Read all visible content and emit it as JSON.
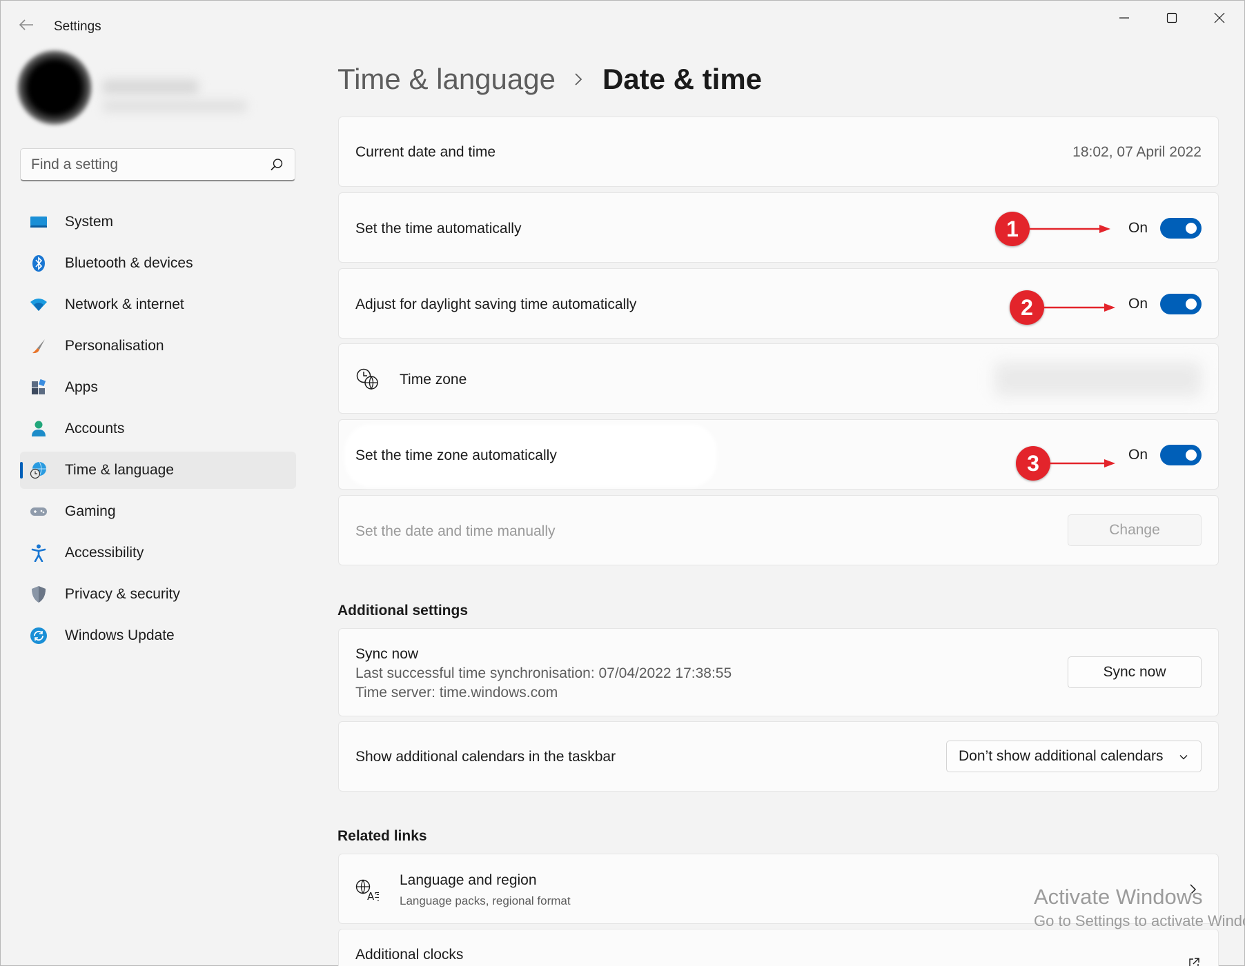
{
  "window": {
    "app_title": "Settings",
    "back_icon": "back-arrow-icon",
    "controls": [
      "minimize-icon",
      "maximize-icon",
      "close-icon"
    ]
  },
  "sidebar": {
    "search_placeholder": "Find a setting",
    "items": [
      {
        "label": "System",
        "icon": "system-display-icon",
        "selected": false
      },
      {
        "label": "Bluetooth & devices",
        "icon": "bluetooth-icon",
        "selected": false
      },
      {
        "label": "Network & internet",
        "icon": "wifi-icon",
        "selected": false
      },
      {
        "label": "Personalisation",
        "icon": "paintbrush-icon",
        "selected": false
      },
      {
        "label": "Apps",
        "icon": "apps-icon",
        "selected": false
      },
      {
        "label": "Accounts",
        "icon": "account-icon",
        "selected": false
      },
      {
        "label": "Time & language",
        "icon": "globe-clock-icon",
        "selected": true
      },
      {
        "label": "Gaming",
        "icon": "gamepad-icon",
        "selected": false
      },
      {
        "label": "Accessibility",
        "icon": "accessibility-icon",
        "selected": false
      },
      {
        "label": "Privacy & security",
        "icon": "shield-icon",
        "selected": false
      },
      {
        "label": "Windows Update",
        "icon": "update-icon",
        "selected": false
      }
    ]
  },
  "header": {
    "parent": "Time & language",
    "current": "Date & time"
  },
  "date_time": {
    "current_label": "Current date and time",
    "current_value": "18:02, 07 April 2022",
    "auto_time_label": "Set the time automatically",
    "auto_time_state": "On",
    "daylight_label": "Adjust for daylight saving time automatically",
    "daylight_state": "On",
    "timezone_label": "Time zone",
    "auto_timezone_label": "Set the time zone automatically",
    "auto_timezone_state": "On",
    "manual_label": "Set the date and time manually",
    "change_button": "Change"
  },
  "annotations": [
    "1",
    "2",
    "3"
  ],
  "additional": {
    "title": "Additional settings",
    "sync_title": "Sync now",
    "sync_last": "Last successful time synchronisation: 07/04/2022 17:38:55",
    "sync_server": "Time server: time.windows.com",
    "sync_button": "Sync now",
    "calendars_label": "Show additional calendars in the taskbar",
    "calendars_value": "Don’t show additional calendars"
  },
  "related": {
    "title": "Related links",
    "lang_title": "Language and region",
    "lang_sub": "Language packs, regional format",
    "clocks_title": "Additional clocks"
  },
  "watermark": {
    "line1": "Activate Windows",
    "line2": "Go to Settings to activate Windows."
  },
  "colors": {
    "accent": "#005fb8",
    "annotation": "#e3242b",
    "background": "#f3f3f3",
    "card": "#fbfbfb"
  }
}
